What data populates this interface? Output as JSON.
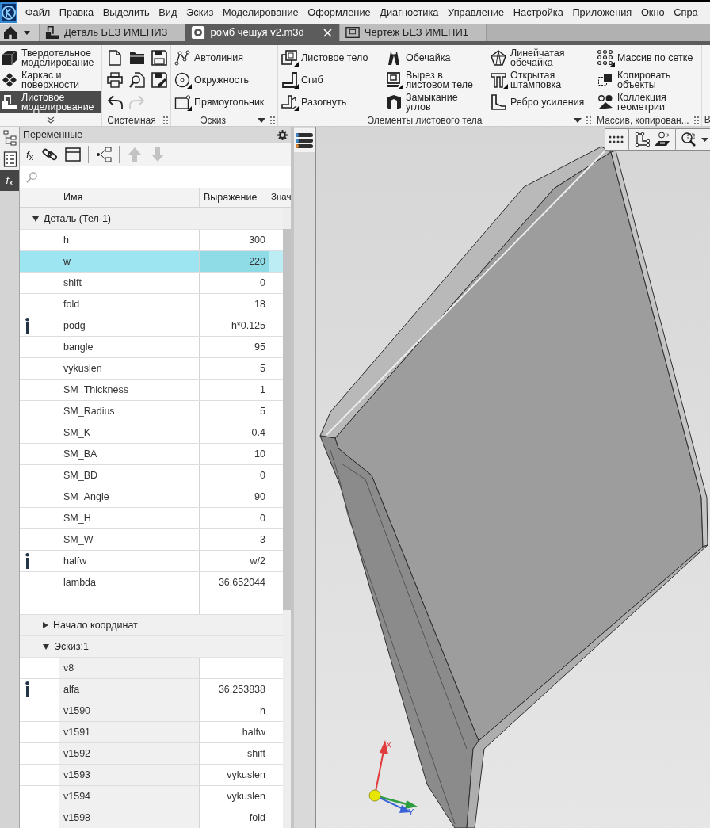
{
  "menu": [
    "Файл",
    "Правка",
    "Выделить",
    "Вид",
    "Эскиз",
    "Моделирование",
    "Оформление",
    "Диагностика",
    "Управление",
    "Настройка",
    "Приложения",
    "Окно",
    "Спра"
  ],
  "home_button": {
    "menu": true
  },
  "documents": [
    {
      "title": "Деталь БЕЗ ИМЕНИЗ",
      "kind": "part",
      "selected": false
    },
    {
      "title": "ромб чешуя v2.m3d",
      "kind": "file",
      "selected": true
    },
    {
      "title": "Чертеж БЕЗ ИМЕНИ1",
      "kind": "drawing",
      "selected": false
    }
  ],
  "ribbon": {
    "modes": [
      {
        "label": "Твердотельное\nмоделирование",
        "kind": "solid",
        "selected": false
      },
      {
        "label": "Каркас и\nповерхности",
        "kind": "wire",
        "selected": false
      },
      {
        "label": "Листовое\nмоделирование",
        "kind": "sheet",
        "selected": true
      }
    ],
    "groups": [
      {
        "title": "Системная",
        "kind": "icon_grid",
        "buttons": [
          {
            "kind": "new",
            "disabled": false
          },
          {
            "kind": "open",
            "disabled": false
          },
          {
            "kind": "save",
            "disabled": false
          },
          {
            "kind": "print",
            "disabled": false
          },
          {
            "kind": "preview",
            "disabled": false
          },
          {
            "kind": "saveas",
            "disabled": false
          },
          {
            "kind": "undo",
            "disabled": false
          },
          {
            "kind": "redo",
            "disabled": true
          }
        ]
      },
      {
        "title": "Эскиз",
        "kind": "tools",
        "menu": true,
        "columns": [
          [
            {
              "label": "Автолиния",
              "kind": "autoline",
              "submenu": false
            },
            {
              "label": "Окружность",
              "kind": "circle",
              "submenu": true
            },
            {
              "label": "Прямоугольник",
              "kind": "rectangle",
              "submenu": true
            }
          ]
        ]
      },
      {
        "title": "Элементы листового тела",
        "kind": "tools",
        "menu": true,
        "columns": [
          [
            {
              "label": "Листовое тело",
              "kind": "sheet",
              "submenu": true
            },
            {
              "label": "Сгиб",
              "kind": "bend",
              "submenu": true
            },
            {
              "label": "Разогнуть",
              "kind": "unbend",
              "submenu": true
            }
          ],
          [
            {
              "label": "Обечайка",
              "kind": "shell",
              "submenu": false
            },
            {
              "label": "Вырез в\nлистовом теле",
              "kind": "cutout",
              "submenu": true
            },
            {
              "label": "Замыкание\nуглов",
              "kind": "corner",
              "submenu": false
            }
          ],
          [
            {
              "label": "Линейчатая\nобечайка",
              "kind": "ruled",
              "submenu": false
            },
            {
              "label": "Открытая\nштамповка",
              "kind": "stamp",
              "submenu": true
            },
            {
              "label": "Ребро усиления",
              "kind": "rib",
              "submenu": false
            }
          ]
        ]
      },
      {
        "title": "Массив, копирован...",
        "kind": "tools",
        "columns": [
          [
            {
              "label": "Массив по сетке",
              "kind": "grid",
              "submenu": true
            },
            {
              "label": "Копировать\nобъекты",
              "kind": "copy",
              "submenu": false
            },
            {
              "label": "Коллекция\nгеометрии",
              "kind": "collection",
              "submenu": false
            }
          ]
        ]
      },
      {
        "title": "В",
        "kind": "partial"
      }
    ]
  },
  "left_tabs": [
    {
      "kind": "tree",
      "selected": false
    },
    {
      "kind": "list",
      "selected": false
    },
    {
      "kind": "formula",
      "label": "*f*$_{x}$",
      "selected": true
    }
  ],
  "variables": {
    "title": "Переменные",
    "toolbar": [
      {
        "kind": "formula",
        "label": "*f*$_{x}$",
        "disabled": false
      },
      {
        "kind": "link",
        "disabled": false
      },
      {
        "kind": "table",
        "disabled": false
      },
      {
        "kind": "separator"
      },
      {
        "kind": "tree",
        "disabled": false
      },
      {
        "kind": "separator"
      },
      {
        "kind": "up",
        "disabled": true
      },
      {
        "kind": "down",
        "disabled": true
      }
    ],
    "columns": [
      "Имя",
      "Выражение",
      "Знач"
    ],
    "groups": [
      {
        "label": "Деталь (Тел-1)",
        "expanded": true,
        "blank_row": true,
        "rows": [
          {
            "name": "h",
            "expression": "300",
            "selected": false,
            "info": false,
            "locked": false
          },
          {
            "name": "w",
            "expression": "220",
            "selected": true,
            "info": false,
            "locked": false
          },
          {
            "name": "shift",
            "expression": "0",
            "selected": false,
            "info": false,
            "locked": false
          },
          {
            "name": "fold",
            "expression": "18",
            "selected": false,
            "info": false,
            "locked": false
          },
          {
            "name": "podg",
            "expression": "h*0.125",
            "selected": false,
            "info": true,
            "locked": false
          },
          {
            "name": "bangle",
            "expression": "95",
            "selected": false,
            "info": false,
            "locked": false
          },
          {
            "name": "vykuslen",
            "expression": "5",
            "selected": false,
            "info": false,
            "locked": false
          },
          {
            "name": "SM_Thickness",
            "expression": "1",
            "selected": false,
            "info": false,
            "locked": false
          },
          {
            "name": "SM_Radius",
            "expression": "5",
            "selected": false,
            "info": false,
            "locked": false
          },
          {
            "name": "SM_K",
            "expression": "0.4",
            "selected": false,
            "info": false,
            "locked": false
          },
          {
            "name": "SM_BA",
            "expression": "10",
            "selected": false,
            "info": false,
            "locked": false
          },
          {
            "name": "SM_BD",
            "expression": "0",
            "selected": false,
            "info": false,
            "locked": false
          },
          {
            "name": "SM_Angle",
            "expression": "90",
            "selected": false,
            "info": false,
            "locked": false
          },
          {
            "name": "SM_H",
            "expression": "0",
            "selected": false,
            "info": false,
            "locked": false
          },
          {
            "name": "SM_W",
            "expression": "3",
            "selected": false,
            "info": false,
            "locked": false
          },
          {
            "name": "halfw",
            "expression": "w/2",
            "selected": false,
            "info": true,
            "locked": false
          },
          {
            "name": "lambda",
            "expression": "36.652044",
            "selected": false,
            "info": false,
            "locked": false
          }
        ],
        "children": [
          {
            "label": "Начало координат",
            "expanded": false
          },
          {
            "label": "Эскиз:1",
            "expanded": true,
            "rows": [
              {
                "name": "v8",
                "selected": false,
                "info": false,
                "locked": true
              },
              {
                "name": "alfa",
                "expression": "36.253838",
                "selected": false,
                "info": true,
                "locked": true
              },
              {
                "name": "v1590",
                "expression": "h",
                "selected": false,
                "info": false,
                "locked": true
              },
              {
                "name": "v1591",
                "expression": "halfw",
                "selected": false,
                "info": false,
                "locked": true
              },
              {
                "name": "v1592",
                "expression": "shift",
                "selected": false,
                "info": false,
                "locked": true
              },
              {
                "name": "v1593",
                "expression": "vykuslen",
                "selected": false,
                "info": false,
                "locked": true
              },
              {
                "name": "v1594",
                "expression": "vykuslen",
                "selected": false,
                "info": false,
                "locked": true
              },
              {
                "name": "v1598",
                "expression": "fold",
                "selected": false,
                "info": false,
                "locked": true
              }
            ]
          }
        ]
      }
    ]
  },
  "viewport": {
    "toolbar": [
      {
        "kind": "grid"
      },
      {
        "kind": "sketch"
      },
      {
        "kind": "orient"
      },
      {
        "kind": "zoom",
        "menu": true
      }
    ],
    "axes": [
      "X",
      "Y"
    ]
  }
}
